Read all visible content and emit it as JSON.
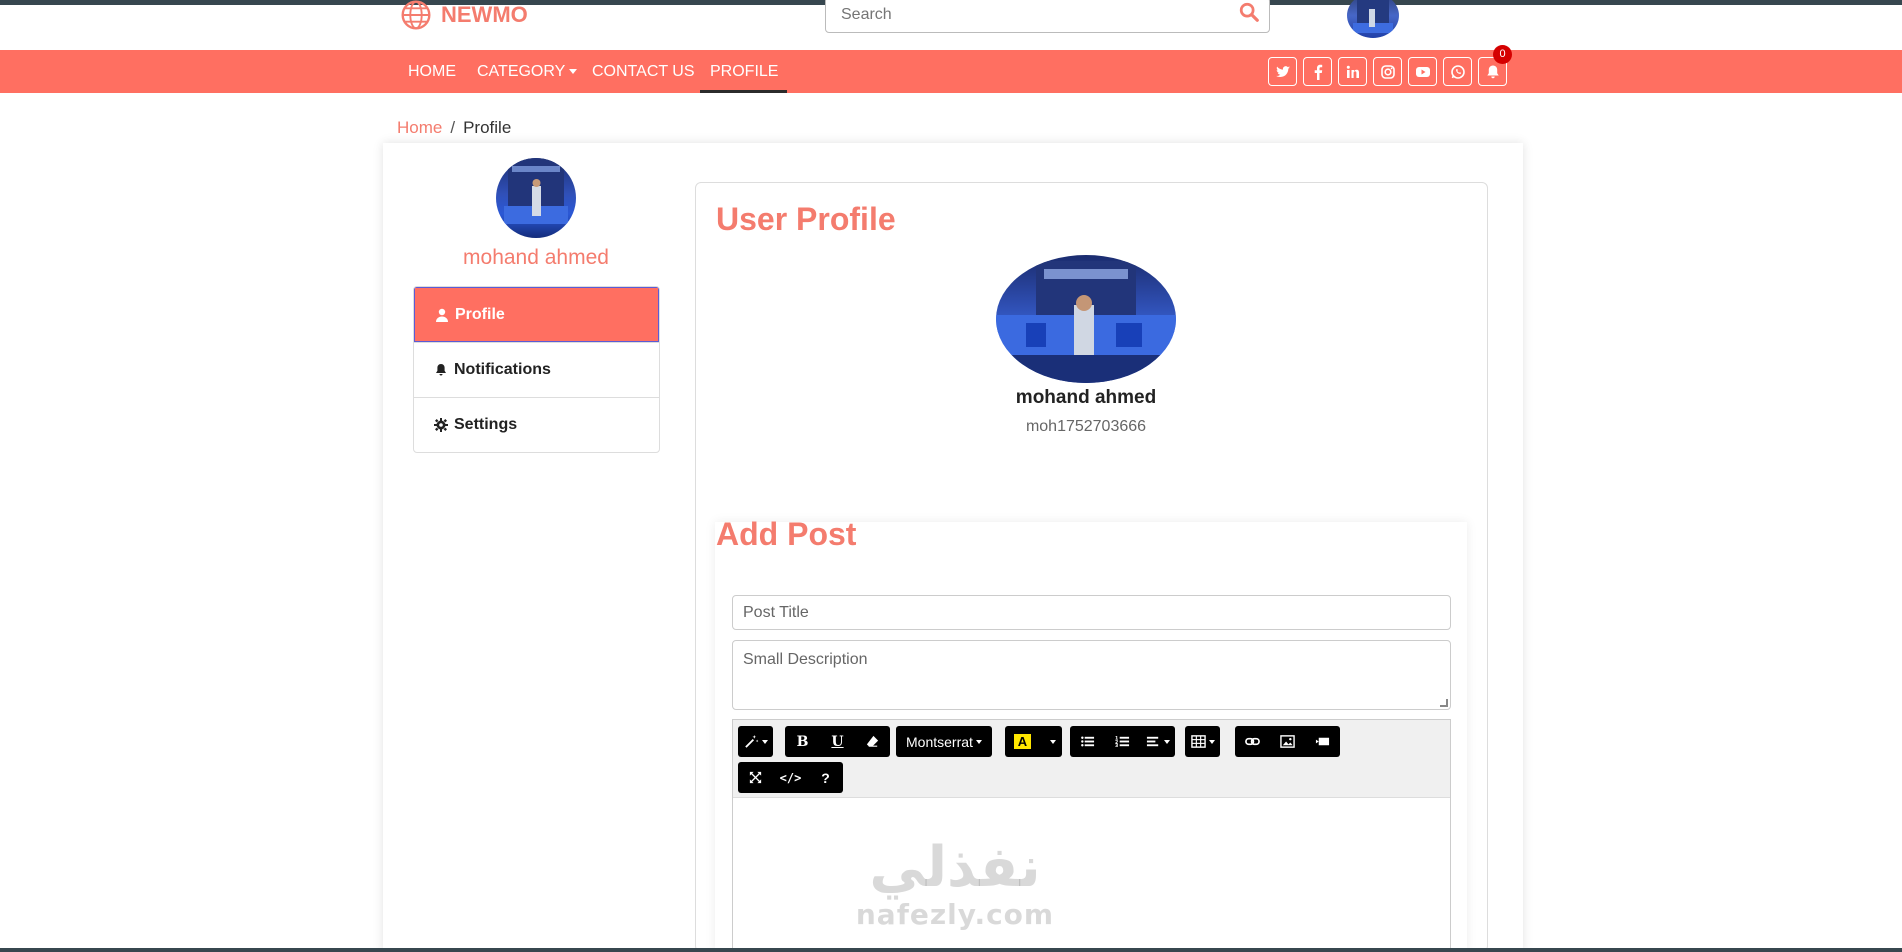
{
  "brand": {
    "name": "NEWMO"
  },
  "search": {
    "placeholder": "Search"
  },
  "nav": {
    "items": [
      {
        "label": "HOME"
      },
      {
        "label": "CATEGORY"
      },
      {
        "label": "CONTACT US"
      },
      {
        "label": "PROFILE"
      }
    ],
    "active": "PROFILE",
    "social_icons": [
      "twitter-icon",
      "facebook-icon",
      "linkedin-icon",
      "instagram-icon",
      "youtube-icon",
      "whatsapp-icon",
      "bell-icon"
    ],
    "notification_count": "0"
  },
  "breadcrumb": {
    "home": "Home",
    "separator": "/",
    "current": "Profile"
  },
  "sidebar": {
    "user_name": "mohand ahmed",
    "items": [
      {
        "label": "Profile",
        "icon": "user-icon"
      },
      {
        "label": "Notifications",
        "icon": "bell-icon"
      },
      {
        "label": "Settings",
        "icon": "gear-icon"
      }
    ]
  },
  "profile": {
    "title": "User Profile",
    "name": "mohand ahmed",
    "username": "moh1752703666"
  },
  "add_post": {
    "title": "Add Post",
    "title_placeholder": "Post Title",
    "description_placeholder": "Small Description",
    "toolbar": {
      "font_name": "Montserrat",
      "buttons": [
        "magic-icon",
        "bold-icon",
        "underline-icon",
        "eraser-icon",
        "font-select",
        "color-icon",
        "unordered-list-icon",
        "ordered-list-icon",
        "paragraph-icon",
        "table-icon",
        "link-icon",
        "picture-icon",
        "video-icon",
        "fullscreen-icon",
        "code-view-icon",
        "help-icon"
      ],
      "bold_label": "B",
      "underline_label": "U",
      "color_label": "A",
      "code_label": "</>",
      "help_label": "?"
    }
  },
  "watermark": {
    "arabic": "نفذلي",
    "latin": "nafezly.com"
  },
  "colors": {
    "accent": "#ff6f61",
    "accent_text": "#f47c6e",
    "badge": "#d50000"
  }
}
